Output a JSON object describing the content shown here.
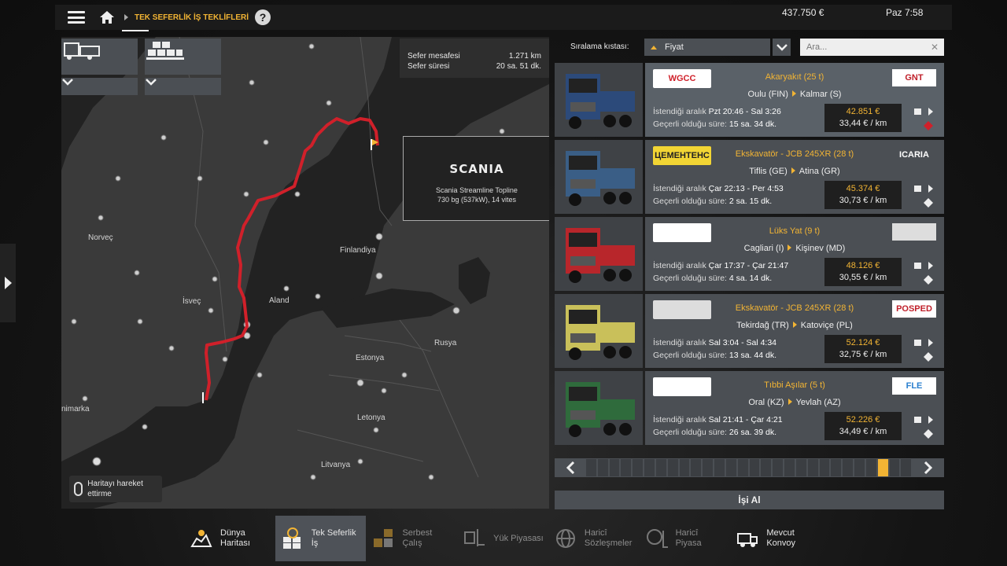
{
  "header": {
    "breadcrumb": "TEK SEFERLİK İŞ TEKLİFLERİ",
    "help": "?",
    "money": "437.750 €",
    "time": "Paz 7:58"
  },
  "map": {
    "info": {
      "distance_label": "Sefer mesafesi",
      "distance_value": "1.271 km",
      "duration_label": "Sefer süresi",
      "duration_value": "20 sa. 51 dk."
    },
    "truck_card": {
      "brand": "SCANIA",
      "model": "Scania Streamline Topline",
      "specs": "730 bg (537kW), 14 vites"
    },
    "labels": {
      "norway": "Norveç",
      "sweden": "İsveç",
      "finland": "Finlandiya",
      "aland": "Aland",
      "russia": "Rusya",
      "estonia": "Estonya",
      "latvia": "Letonya",
      "lithuania": "Litvanya",
      "denmark": "nimarka"
    },
    "hint": "Haritayı hareket ettirme"
  },
  "sort": {
    "label": "Sıralama kıstası:",
    "value": "Fiyat",
    "search_placeholder": "Ara..."
  },
  "jobs": [
    {
      "company": "WGCC",
      "cargo": "Akaryakıt (25 t)",
      "from": "Oulu (FIN)",
      "to": "Kalmar (S)",
      "dest_company": "GNT",
      "interval_label": "İstendiği aralık",
      "interval": "Pzt 20:46 - Sal 3:26",
      "valid_label": "Geçerli olduğu süre:",
      "valid": "15 sa. 34 dk.",
      "price": "42.851 €",
      "per_km": "33,44 € / km",
      "truck_color": "#2c4a7a"
    },
    {
      "company": "ЦЕМЕНТЕНС",
      "cargo": "Ekskavatör - JCB 245XR (28 t)",
      "from": "Tiflis (GE)",
      "to": "Atina (GR)",
      "dest_company": "ICARIA",
      "interval_label": "İstendiği aralık",
      "interval": "Çar 22:13 - Per 4:53",
      "valid_label": "Geçerli olduğu süre:",
      "valid": "2 sa. 15 dk.",
      "price": "45.374 €",
      "per_km": "30,73 € / km",
      "truck_color": "#3a5e86"
    },
    {
      "company": "",
      "cargo": "Lüks Yat (9 t)",
      "from": "Cagliari (I)",
      "to": "Kişinev (MD)",
      "dest_company": "",
      "interval_label": "İstendiği aralık",
      "interval": "Çar 17:37 - Çar 21:47",
      "valid_label": "Geçerli olduğu süre:",
      "valid": "4 sa. 14 dk.",
      "price": "48.126 €",
      "per_km": "30,55 € / km",
      "truck_color": "#b8262b"
    },
    {
      "company": "",
      "cargo": "Ekskavatör - JCB 245XR (28 t)",
      "from": "Tekirdağ (TR)",
      "to": "Katoviçe (PL)",
      "dest_company": "POSPED",
      "interval_label": "İstendiği aralık",
      "interval": "Sal 3:04 - Sal 4:34",
      "valid_label": "Geçerli olduğu süre:",
      "valid": "13 sa. 44 dk.",
      "price": "52.124 €",
      "per_km": "32,75 € / km",
      "truck_color": "#c9c05a"
    },
    {
      "company": "",
      "cargo": "Tıbbi Aşılar (5 t)",
      "from": "Oral (KZ)",
      "to": "Yevlah (AZ)",
      "dest_company": "FLE",
      "interval_label": "İstendiği aralık",
      "interval": "Sal 21:41 - Çar 4:21",
      "valid_label": "Geçerli olduğu süre:",
      "valid": "26 sa. 39 dk.",
      "price": "52.226 €",
      "per_km": "34,49 € / km",
      "truck_color": "#2f6b3c"
    }
  ],
  "pager": {
    "total": 28,
    "current": 26
  },
  "take_job": "İşi Al",
  "nav": [
    {
      "label1": "Dünya",
      "label2": "Haritası"
    },
    {
      "label1": "Tek Seferlik",
      "label2": "İş"
    },
    {
      "label1": "Serbest",
      "label2": "Çalış"
    },
    {
      "label1": "Yük Piyasası",
      "label2": ""
    },
    {
      "label1": "Haricî",
      "label2": "Sözleşmeler"
    },
    {
      "label1": "Haricî",
      "label2": "Piyasa"
    },
    {
      "label1": "Mevcut",
      "label2": "Konvoy"
    }
  ],
  "colors": {
    "accent": "#f2b434",
    "route": "#d0202a",
    "panel": "#4b4f54"
  }
}
